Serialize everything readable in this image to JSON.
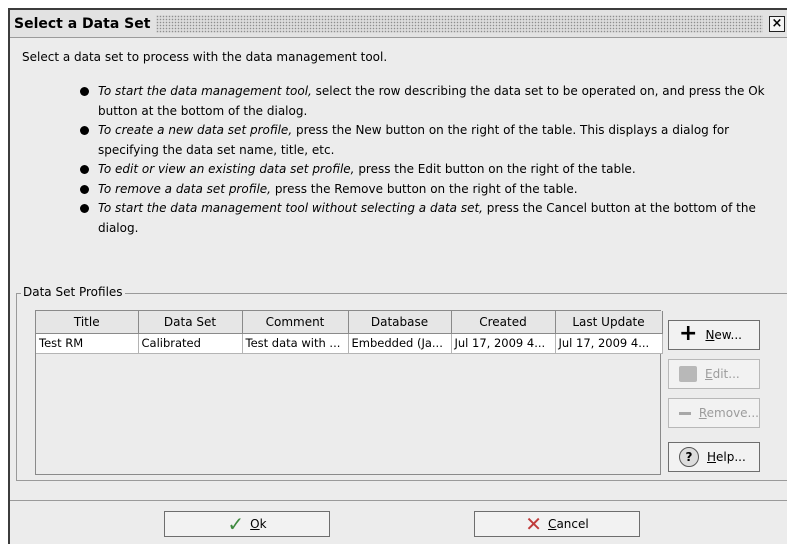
{
  "window": {
    "title": "Select a Data Set",
    "close_glyph": "×"
  },
  "intro": "Select a data set to process with the data management tool.",
  "bullets": [
    {
      "lead": "To start the data management tool,",
      "text": " select the row describing the data set to be operated on, and press the Ok button at the bottom of the dialog."
    },
    {
      "lead": "To create a new data set profile,",
      "text": " press the New button on the right of the table. This displays a dialog for specifying the data set name, title, etc."
    },
    {
      "lead": "To edit or view an existing data set profile,",
      "text": " press the Edit button on the right of the table."
    },
    {
      "lead": "To remove a data set profile,",
      "text": " press the Remove button on the right of the table."
    },
    {
      "lead": "To start the data management tool without selecting a data set,",
      "text": " press the Cancel button at the bottom of the dialog."
    }
  ],
  "profiles": {
    "legend": "Data Set Profiles",
    "columns": [
      "Title",
      "Data Set",
      "Comment",
      "Database",
      "Created",
      "Last Update"
    ],
    "rows": [
      [
        "Test RM",
        "Calibrated",
        "Test data with ...",
        "Embedded (Ja...",
        "Jul 17, 2009 4...",
        "Jul 17, 2009 4..."
      ]
    ],
    "buttons": {
      "new": {
        "mnemonic": "N",
        "rest": "ew...",
        "icon": "plus-icon",
        "enabled": true
      },
      "edit": {
        "mnemonic": "E",
        "rest": "dit...",
        "icon": "edit-icon",
        "enabled": false
      },
      "remove": {
        "mnemonic": "R",
        "rest": "emove...",
        "icon": "minus-icon",
        "enabled": false
      },
      "help": {
        "mnemonic": "H",
        "rest": "elp...",
        "icon": "help-icon",
        "glyph": "?",
        "enabled": true
      }
    }
  },
  "footer": {
    "ok": {
      "mnemonic": "O",
      "rest": "k",
      "icon": "checkmark-icon",
      "glyph": "✓"
    },
    "cancel": {
      "mnemonic": "C",
      "rest": "ancel",
      "icon": "x-icon",
      "glyph": "✕"
    }
  },
  "colors": {
    "background": "#ececec",
    "ok_icon": "#3f8a3f",
    "cancel_icon": "#c03b3b"
  }
}
